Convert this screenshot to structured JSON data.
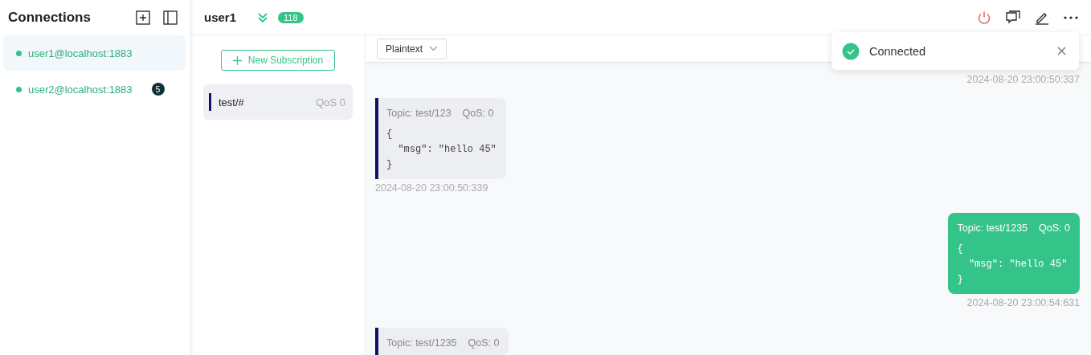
{
  "sidebar": {
    "title": "Connections",
    "connections": [
      {
        "name": "user1@localhost:1883",
        "selected": true
      },
      {
        "name": "user2@localhost:1883",
        "selected": false,
        "unread": "5"
      }
    ]
  },
  "header": {
    "title": "user1",
    "count": "118"
  },
  "new_subscription": "New Subscription",
  "subscriptions": [
    {
      "topic": "test/#",
      "qos": "QoS 0",
      "selected": true,
      "color": "#11116a"
    }
  ],
  "format": "Plaintext",
  "toast": {
    "message": "Connected"
  },
  "messages": [
    {
      "kind": "sent",
      "time": "2024-08-20 23:00:50:337"
    },
    {
      "kind": "received",
      "topic": "Topic: test/123",
      "qos": "QoS: 0",
      "payload": [
        "{",
        "  \"msg\": \"hello 45\"",
        "}"
      ],
      "time": "2024-08-20 23:00:50:339"
    },
    {
      "kind": "sent",
      "topic": "Topic: test/1235",
      "qos": "QoS: 0",
      "payload": [
        "{",
        "  \"msg\": \"hello 45\"",
        "}"
      ],
      "time": "2024-08-20 23:00:54:631"
    },
    {
      "kind": "received",
      "topic": "Topic: test/1235",
      "qos": "QoS: 0"
    }
  ]
}
